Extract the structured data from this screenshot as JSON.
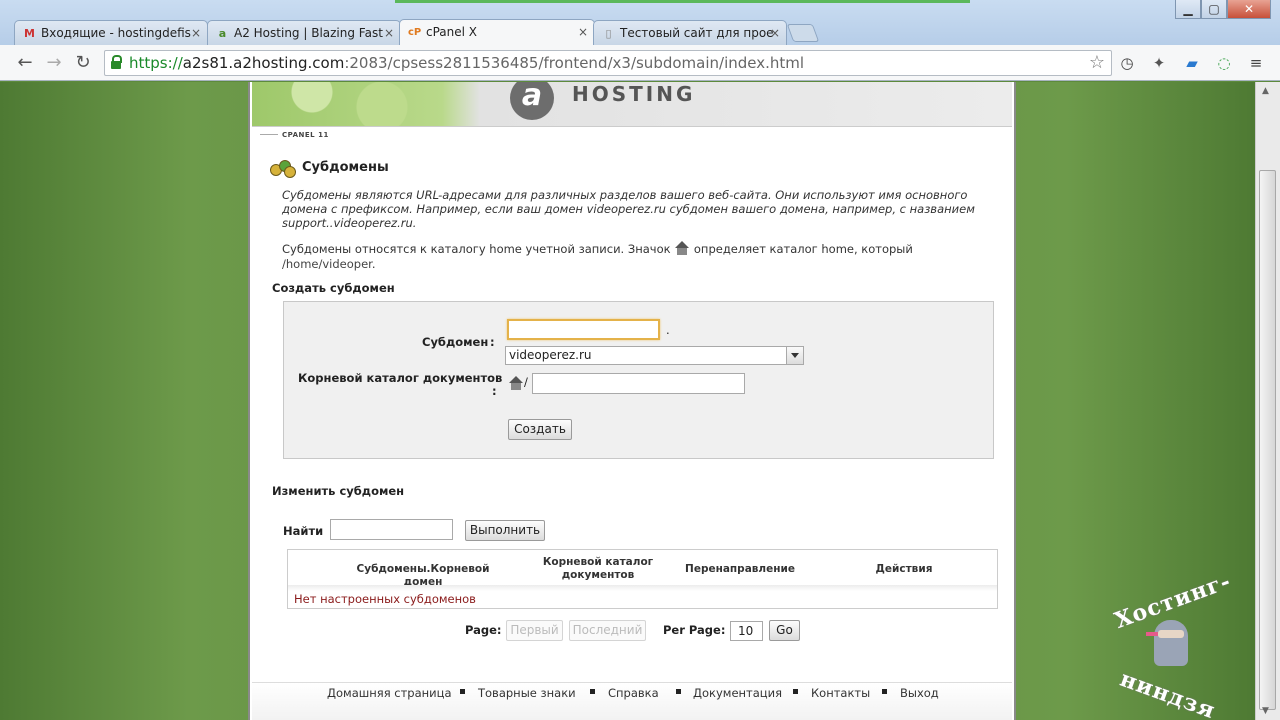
{
  "browser": {
    "tabs": [
      {
        "label": "Входящие - hostingdefis",
        "icon": "gmail-icon",
        "active": false
      },
      {
        "label": "A2 Hosting | Blazing Fast",
        "icon": "a2-icon",
        "active": false
      },
      {
        "label": "cPanel X",
        "icon": "cpanel-icon",
        "active": true
      },
      {
        "label": "Тестовый сайт для прое",
        "icon": "page-icon",
        "active": false
      }
    ],
    "window_controls": {
      "minimize": "▁",
      "maximize": "▢",
      "close": "✕"
    },
    "url": {
      "scheme": "https://",
      "domain": "a2s81.a2hosting.com",
      "path": ":2083/cpsess2811536485/frontend/x3/subdomain/index.html"
    }
  },
  "banner": {
    "logo_letter": "a",
    "brand": "HOSTING",
    "cpanel_label": "CPANEL 11"
  },
  "page": {
    "title": "Субдомены",
    "description_line1": "Субдомены являются URL-адресами для различных разделов вашего веб-сайта. Они используют имя основного",
    "description_line2": "домена с префиксом. Например, если ваш домен videoperez.ru субдомен вашего домена, например, с названием",
    "description_line3": "support..videoperez.ru.",
    "home_note_before": "Субдомены относятся к каталогу home учетной записи. Значок",
    "home_note_after": "определяет каталог home, который",
    "home_path": "/home/videoper",
    "home_path_suffix": "."
  },
  "create": {
    "heading": "Создать субдомен",
    "subdomain_label": "Субдомен",
    "colon": ":",
    "dot": ".",
    "subdomain_value": "",
    "domain_selected": "videoperez.ru",
    "docroot_label": "Корневой каталог документов",
    "docroot_slash": "/",
    "docroot_value": "",
    "submit": "Создать"
  },
  "modify": {
    "heading": "Изменить субдомен",
    "search_label": "Найти",
    "search_value": "",
    "search_button": "Выполнить",
    "columns": [
      "Субдомены.Корневой домен",
      "Корневой каталог документов",
      "Перенаправление",
      "Действия"
    ],
    "empty": "Нет настроенных субдоменов"
  },
  "pagination": {
    "page_label": "Page:",
    "first": "Первый",
    "last": "Последний",
    "per_page_label": "Per Page:",
    "per_page_value": "10",
    "go": "Go"
  },
  "footer": [
    "Домашняя страница",
    "Товарные знаки",
    "Справка",
    "Документация",
    "Контакты",
    "Выход"
  ],
  "watermark": {
    "top": "Хостинг-",
    "bottom": "ниндзя"
  },
  "colors": {
    "accent": "#5d8a3c",
    "error_text": "#8a1a1a",
    "focus": "#e4b24a"
  }
}
